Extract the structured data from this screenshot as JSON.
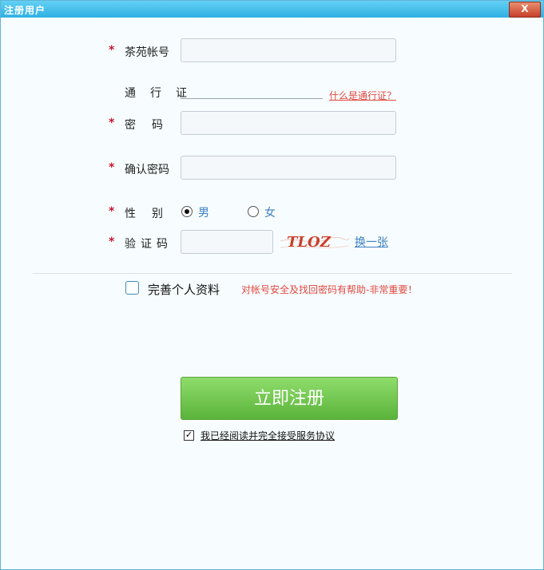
{
  "window": {
    "title": "注册用户",
    "close_label": "X"
  },
  "form": {
    "account": {
      "label": "茶苑帐号",
      "value": "",
      "placeholder": ""
    },
    "passport": {
      "label": "通行证",
      "help_link": "什么是通行证？"
    },
    "password": {
      "label": "密码",
      "value": ""
    },
    "confirm_password": {
      "label": "确认密码",
      "value": ""
    },
    "gender": {
      "label": "性别",
      "options": [
        "男",
        "女"
      ],
      "selected": "男"
    },
    "captcha": {
      "label": "验证码",
      "value": "",
      "image_text": "TLOZ",
      "refresh_label": "换一张"
    },
    "required_mark": "*"
  },
  "profile": {
    "label": "完善个人资料",
    "hint": "对帐号安全及找回密码有帮助-非常重要！",
    "checked": false
  },
  "submit_label": "立即注册",
  "agreement": {
    "label": "我已经阅读并完全接受服务协议",
    "checked": true,
    "check_mark": "✓"
  }
}
